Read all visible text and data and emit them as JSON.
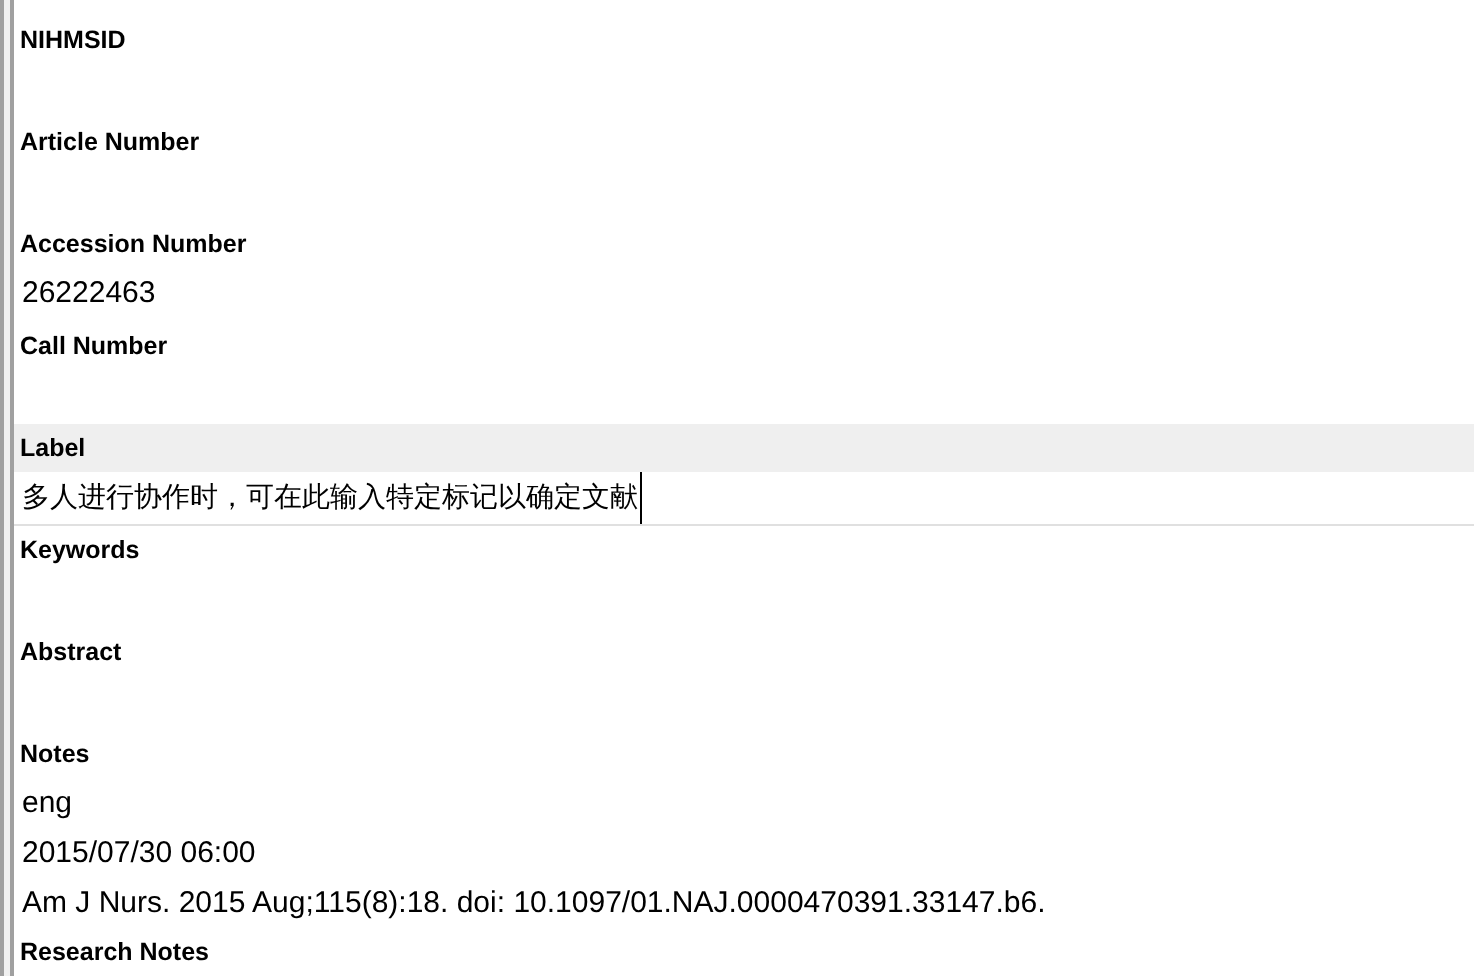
{
  "fields": [
    {
      "label": "NIHMSID",
      "selected": false
    },
    {
      "label": "Article Number",
      "selected": false
    },
    {
      "label": "Accession Number",
      "values": [
        "26222463"
      ],
      "selected": false
    },
    {
      "label": "Call Number",
      "selected": false
    },
    {
      "label": "Label",
      "values": [
        "多人进行协作时，可在此输入特定标记以确定文献"
      ],
      "selected": true
    },
    {
      "label": "Keywords",
      "selected": false
    },
    {
      "label": "Abstract",
      "selected": false
    },
    {
      "label": "Notes",
      "values": [
        "eng",
        "2015/07/30 06:00",
        "Am J Nurs. 2015 Aug;115(8):18. doi: 10.1097/01.NAJ.0000470391.33147.b6."
      ],
      "selected": false
    },
    {
      "label": "Research Notes",
      "selected": false
    }
  ]
}
